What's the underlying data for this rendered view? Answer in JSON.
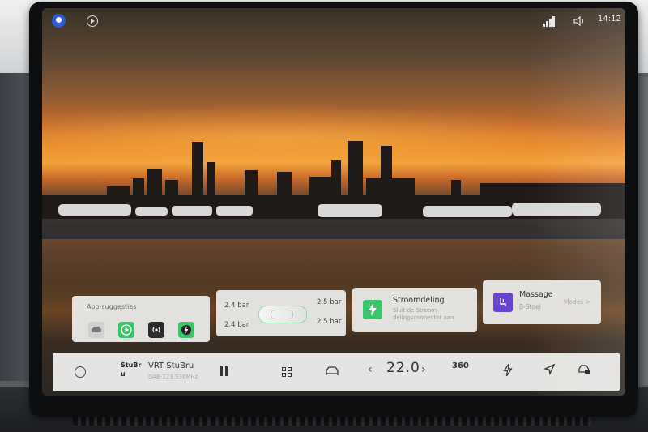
{
  "status_bar": {
    "time": "14:12"
  },
  "widgets": {
    "app_suggestions": {
      "title": "App-suggesties",
      "apps": [
        {
          "icon": "car-service-icon",
          "color": "#9a9a9a"
        },
        {
          "icon": "carplay-play-icon",
          "color": "#3cc46b"
        },
        {
          "icon": "radio-waves-icon",
          "color": "#333333"
        },
        {
          "icon": "charging-bolt-icon",
          "color": "#3cc46b"
        }
      ]
    },
    "tire_pressure": {
      "front_left": "2.4 bar",
      "front_right": "2.5 bar",
      "rear_left": "2.4 bar",
      "rear_right": "2.5 bar"
    },
    "power_sharing": {
      "title": "Stroomdeling",
      "subtitle": "Sluit de Stroom-delingsconnector aan",
      "icon_color": "#3cc46b"
    },
    "massage": {
      "title": "Massage",
      "subtitle": "B-Stoel",
      "link": "Modes >",
      "icon_color": "#6a43d1"
    }
  },
  "bottom_bar": {
    "station_logo": "StuBru",
    "station_name": "VRT StuBru",
    "station_freq": "DAB-223.936MHz",
    "temperature": "22.0",
    "icon_360": "360"
  }
}
